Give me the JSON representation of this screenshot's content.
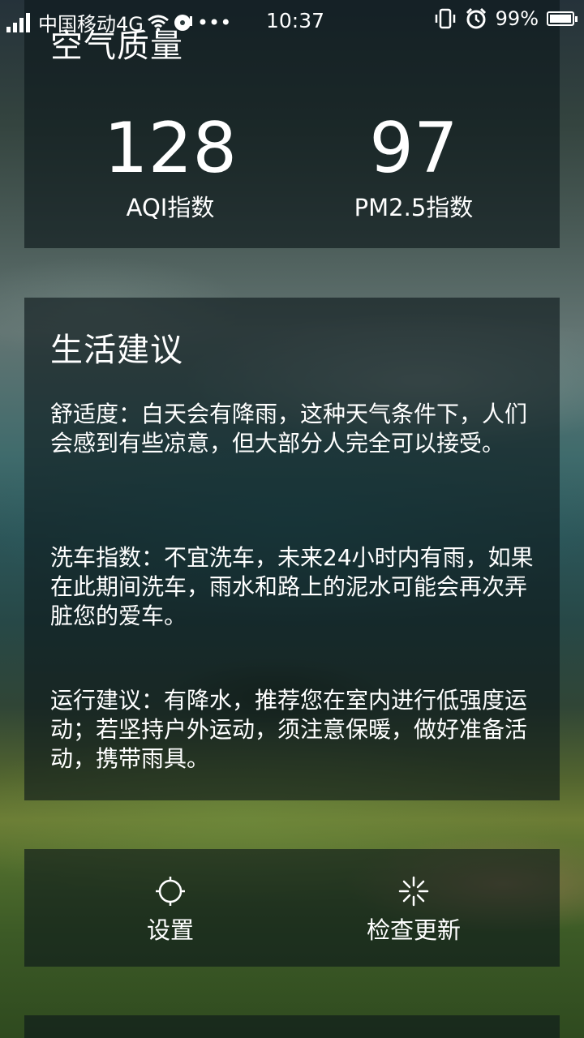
{
  "status_bar": {
    "carrier": "中国移动4G",
    "extra": "•••",
    "time": "10:37",
    "battery": "99%",
    "battery_level": 0.99
  },
  "air_quality": {
    "title": "空气质量",
    "aqi_value": "128",
    "aqi_label": "AQI指数",
    "pm25_value": "97",
    "pm25_label": "PM2.5指数"
  },
  "life_advice": {
    "title": "生活建议",
    "items": [
      "舒适度：白天会有降雨，这种天气条件下，人们会感到有些凉意，但大部分人完全可以接受。",
      "洗车指数：不宜洗车，未来24小时内有雨，如果在此期间洗车，雨水和路上的泥水可能会再次弄脏您的爱车。",
      "运行建议：有降水，推荐您在室内进行低强度运动；若坚持户外运动，须注意保暖，做好准备活动，携带雨具。"
    ]
  },
  "actions": {
    "settings_label": "设置",
    "update_label": "检查更新"
  }
}
